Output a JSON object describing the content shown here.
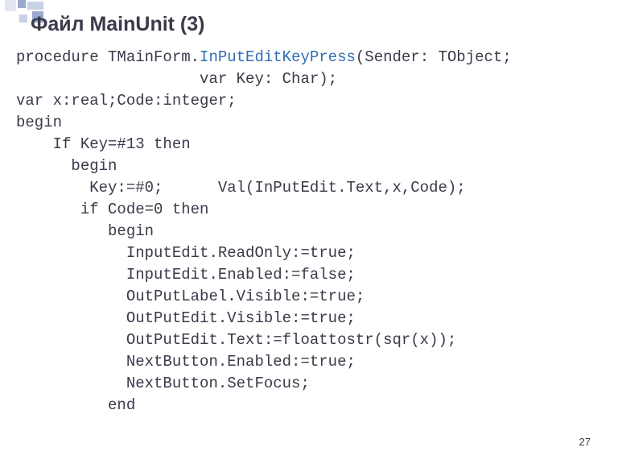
{
  "title": "Файл MainUnit (3)",
  "page_number": "27",
  "code": {
    "l1a": "procedure TMainForm.",
    "l1fn": "InPutEditKeyPress",
    "l1b": "(Sender: TObject;",
    "l2": "                    var Key: Char);",
    "l3": "var x:real;Code:integer;",
    "l4": "begin",
    "l5": "    If Key=#13 then",
    "l6": "      begin",
    "l7": "        Key:=#0;      Val(InPutEdit.Text,x,Code);",
    "l8": "       if Code=0 then",
    "l9": "          begin",
    "l10": "            InputEdit.ReadOnly:=true;",
    "l11": "            InputEdit.Enabled:=false;",
    "l12": "            OutPutLabel.Visible:=true;",
    "l13": "            OutPutEdit.Visible:=true;",
    "l14": "            OutPutEdit.Text:=floattostr(sqr(x));",
    "l15": "            NextButton.Enabled:=true;",
    "l16": "            NextButton.SetFocus;",
    "l17": "          end"
  }
}
